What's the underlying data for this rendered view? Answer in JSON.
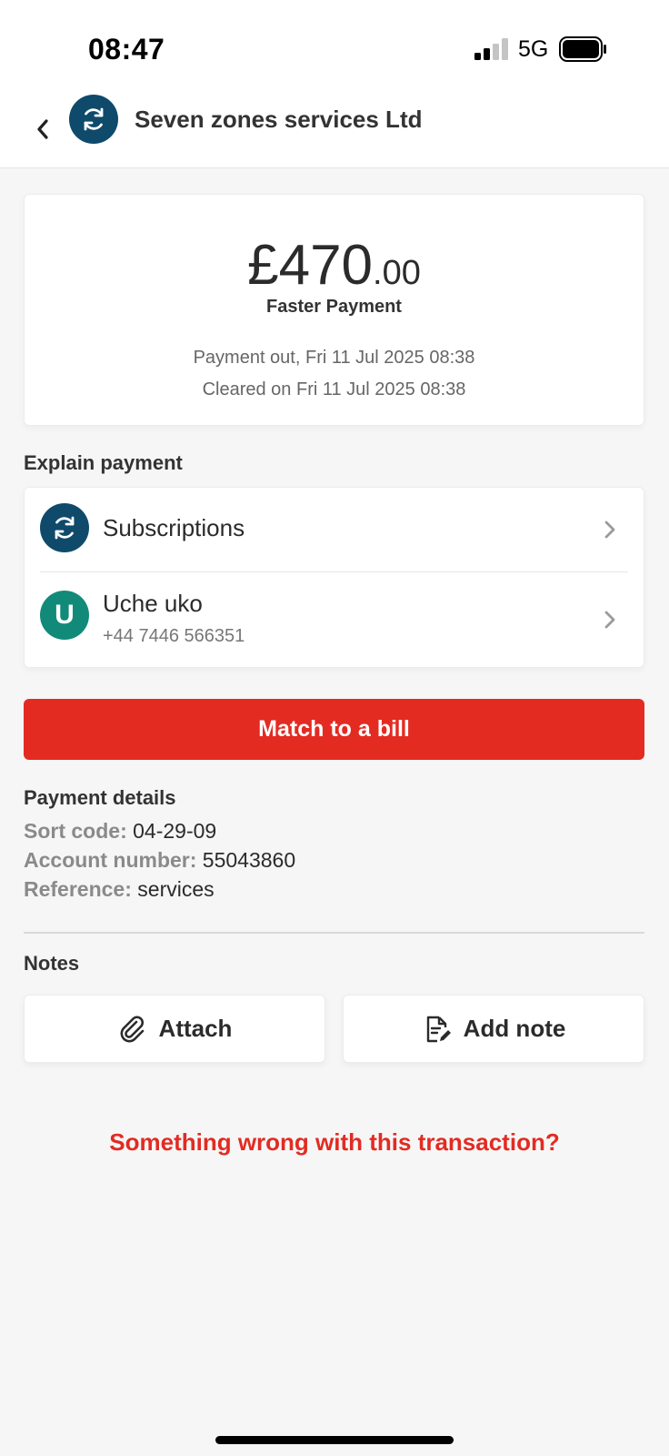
{
  "status_bar": {
    "time": "08:47",
    "network": "5G",
    "icons": [
      "signal-icon",
      "battery-icon"
    ]
  },
  "header": {
    "title": "Seven zones services Ltd",
    "icons": [
      "chevron-left-icon",
      "sync-icon"
    ]
  },
  "transaction": {
    "amount_major": "£470",
    "amount_minor": ".00",
    "payment_type": "Faster Payment",
    "payment_out": "Payment out, Fri 11 Jul 2025 08:38",
    "cleared": "Cleared on Fri 11 Jul 2025 08:38"
  },
  "explain": {
    "title": "Explain payment",
    "category": {
      "label": "Subscriptions",
      "icon": "sync-icon"
    },
    "contact": {
      "initial": "U",
      "name": "Uche uko",
      "phone": "+44 7446 566351"
    }
  },
  "match_button_label": "Match to a bill",
  "payment_details": {
    "title": "Payment details",
    "sort_code_label": "Sort code:",
    "sort_code": "04-29-09",
    "account_number_label": "Account number:",
    "account_number": "55043860",
    "reference_label": "Reference:",
    "reference": "services"
  },
  "notes": {
    "title": "Notes",
    "attach_label": "Attach",
    "add_note_label": "Add note",
    "icons": [
      "paperclip-icon",
      "note-edit-icon"
    ]
  },
  "report_link": "Something wrong with this transaction?",
  "colors": {
    "accent_red": "#e32b22",
    "avatar_navy": "#0f4a6b",
    "avatar_teal": "#128a7a",
    "background": "#f6f6f6"
  }
}
